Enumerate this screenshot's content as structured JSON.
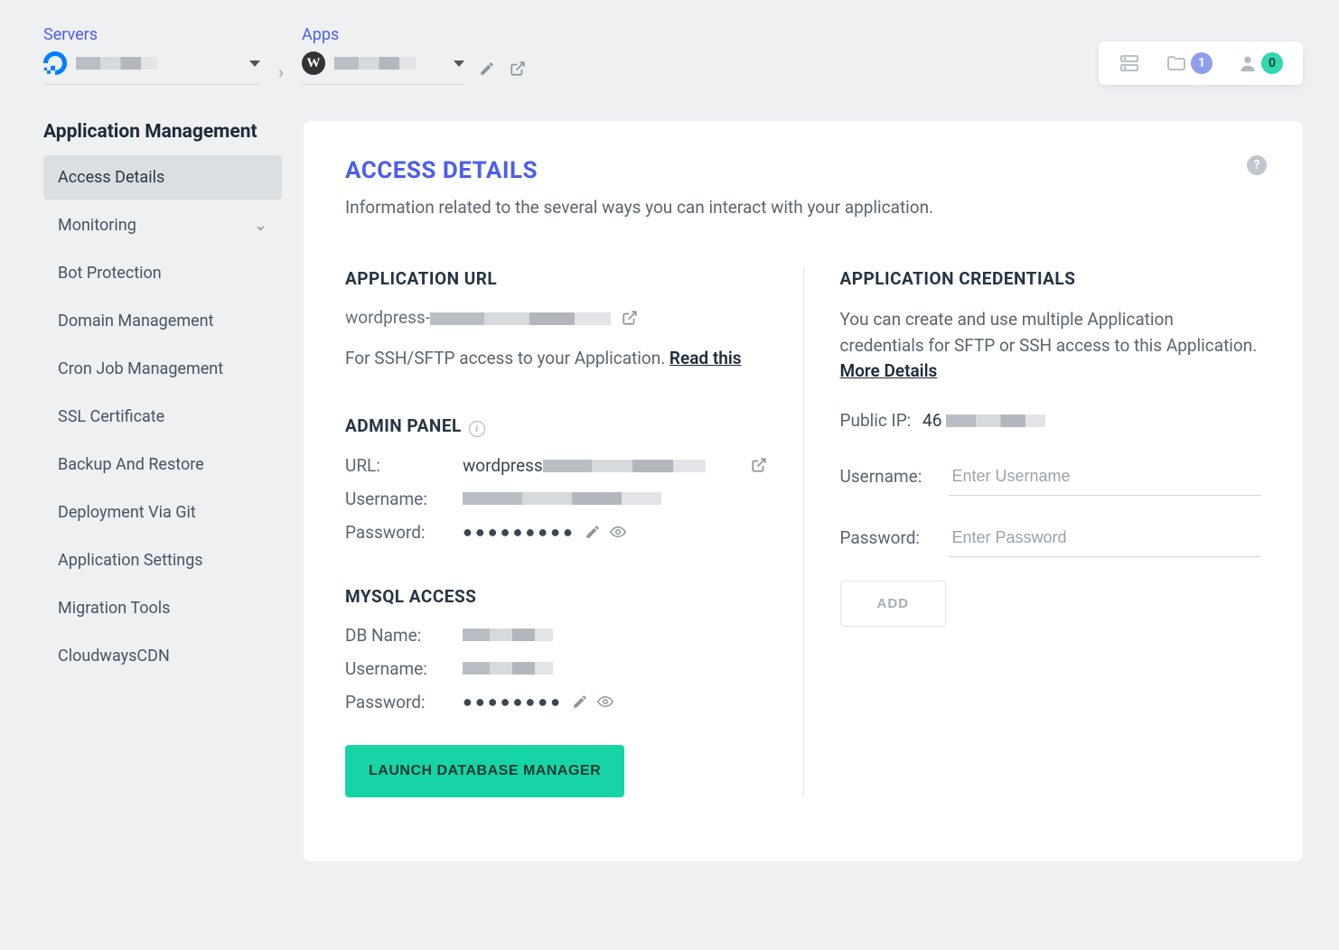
{
  "topbar": {
    "servers_label": "Servers",
    "apps_label": "Apps",
    "server_name_redacted": true,
    "app_name_redacted": true,
    "badge_folder": "1",
    "badge_user": "0"
  },
  "sidebar": {
    "title": "Application Management",
    "items": [
      {
        "label": "Access Details",
        "active": true,
        "expandable": false
      },
      {
        "label": "Monitoring",
        "active": false,
        "expandable": true
      },
      {
        "label": "Bot Protection",
        "active": false,
        "expandable": false
      },
      {
        "label": "Domain Management",
        "active": false,
        "expandable": false
      },
      {
        "label": "Cron Job Management",
        "active": false,
        "expandable": false
      },
      {
        "label": "SSL Certificate",
        "active": false,
        "expandable": false
      },
      {
        "label": "Backup And Restore",
        "active": false,
        "expandable": false
      },
      {
        "label": "Deployment Via Git",
        "active": false,
        "expandable": false
      },
      {
        "label": "Application Settings",
        "active": false,
        "expandable": false
      },
      {
        "label": "Migration Tools",
        "active": false,
        "expandable": false
      },
      {
        "label": "CloudwaysCDN",
        "active": false,
        "expandable": false
      }
    ]
  },
  "panel": {
    "title": "ACCESS DETAILS",
    "subtitle": "Information related to the several ways you can interact with your application.",
    "app_url": {
      "heading": "APPLICATION URL",
      "url_prefix": "wordpress-",
      "ssh_note_prefix": "For SSH/SFTP access to your Application. ",
      "ssh_note_link": "Read this"
    },
    "admin_panel": {
      "heading": "ADMIN PANEL",
      "url_label": "URL:",
      "url_value_prefix": "wordpress",
      "username_label": "Username:",
      "password_label": "Password:",
      "password_mask": "●●●●●●●●●"
    },
    "mysql": {
      "heading": "MYSQL ACCESS",
      "db_label": "DB Name:",
      "user_label": "Username:",
      "pass_label": "Password:",
      "password_mask": "●●●●●●●●",
      "launch_button": "LAUNCH DATABASE MANAGER"
    },
    "credentials": {
      "heading": "APPLICATION CREDENTIALS",
      "desc_prefix": "You can create and use multiple Application credentials for SFTP or SSH access to this Application. ",
      "desc_link": "More Details",
      "public_ip_label": "Public IP:",
      "public_ip_prefix": "46",
      "username_label": "Username:",
      "username_placeholder": "Enter Username",
      "password_label": "Password:",
      "password_placeholder": "Enter Password",
      "add_button": "ADD"
    }
  }
}
